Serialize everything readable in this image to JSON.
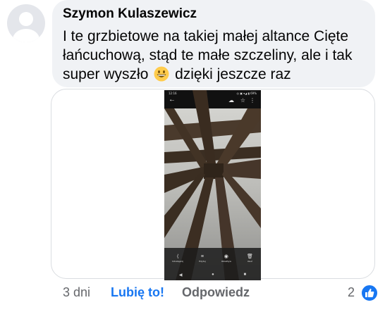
{
  "comment": {
    "author": "Szymon Kulaszewicz",
    "text_before_emoji": "I te grzbietowe na takiej małej altance Cięte łańcuchową, stąd te małe szczeliny, ale i tak super wyszło",
    "emoji": "grinning-face-emoji",
    "text_after_emoji": "dzięki jeszcze raz"
  },
  "attachment": {
    "status_time": "12:16",
    "status_icons": "◎ ▣ ▾◢ ▮ 69%",
    "toolbar": [
      {
        "icon": "share-icon",
        "glyph": "⟨",
        "label": "Udostępnij"
      },
      {
        "icon": "edit-icon",
        "glyph": "≡",
        "label": "Edytuj"
      },
      {
        "icon": "lens-icon",
        "glyph": "◉",
        "label": "Obiektyw"
      },
      {
        "icon": "delete-icon",
        "glyph": "🗑",
        "label": "Usuń"
      }
    ],
    "nav": {
      "back": "◀",
      "home": "●",
      "recents": "■"
    }
  },
  "footer": {
    "time": "3 dni",
    "like": "Lubię to!",
    "reply": "Odpowiedz",
    "reaction_count": "2"
  },
  "colors": {
    "accent": "#1877f2",
    "bubble": "#f0f2f5",
    "muted": "#65676b"
  }
}
